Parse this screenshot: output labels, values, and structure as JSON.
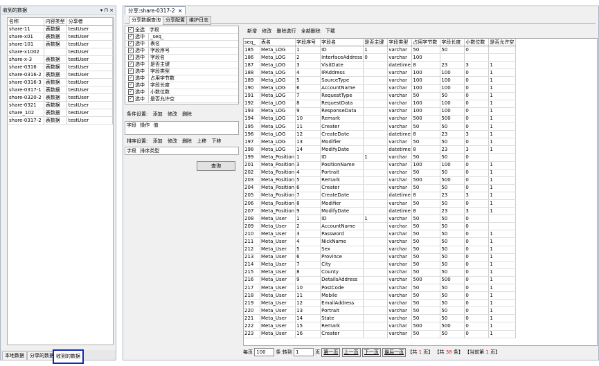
{
  "left_panel": {
    "title": "收到的数据",
    "controls": "▾ ⊓ ×",
    "columns": [
      "名称",
      "内容类型",
      "分享者"
    ],
    "rows": [
      [
        "share-11",
        "表数据",
        "testUser"
      ],
      [
        "share-x01",
        "表数据",
        "testUser"
      ],
      [
        "share-101",
        "表数据",
        "testUser"
      ],
      [
        "share-x1002",
        "",
        "testUser"
      ],
      [
        "share-x-3",
        "表数据",
        "testUser"
      ],
      [
        "share-0316",
        "表数据",
        "testUser"
      ],
      [
        "share-0316-2",
        "表数据",
        "testUser"
      ],
      [
        "share-0316-3",
        "表数据",
        "testUser"
      ],
      [
        "share-0317-1",
        "表数据",
        "testUser"
      ],
      [
        "share-0320-2",
        "表数据",
        "testUser"
      ],
      [
        "share-0321",
        "表数据",
        "testUser"
      ],
      [
        "share_102",
        "表数据",
        "testUser"
      ],
      [
        "share-0317-2",
        "表数据",
        "testUser"
      ]
    ],
    "bottom_tabs": [
      "本地数据",
      "分享的数据",
      "收到的数据"
    ]
  },
  "doc_tab": {
    "title": "分享:share-0317-2",
    "close": "×"
  },
  "sub_tabs": [
    "分享数据查询",
    "分享配置",
    "维护日志"
  ],
  "fields": {
    "select_all": "全选",
    "field_header": "字段",
    "select_label": "选中",
    "items": [
      "_seq_",
      "表名",
      "字段序号",
      "字段名",
      "是否主键",
      "字段类型",
      "占用字节数",
      "字段长度",
      "小数位数",
      "是否允许空"
    ]
  },
  "condition": {
    "label": "条件设置:",
    "actions": [
      "添加",
      "修改",
      "删除"
    ],
    "columns": [
      "字段",
      "操作",
      "值"
    ]
  },
  "sort": {
    "label": "排序设置:",
    "actions": [
      "添加",
      "修改",
      "删除",
      "上移",
      "下移"
    ],
    "columns": [
      "字段",
      "排序类型"
    ]
  },
  "query_button": "查询",
  "grid_toolbar": [
    "新增",
    "修改",
    "删除选行",
    "全部删除",
    "下载"
  ],
  "grid": {
    "columns": [
      "seq_",
      "表名",
      "字段序号",
      "字段名",
      "是否主键",
      "字段类型",
      "占用字节数",
      "字段长度",
      "小数位数",
      "是否允许空"
    ],
    "rows": [
      [
        "185",
        "Meta_LOG",
        "1",
        "ID",
        "1",
        "varchar",
        "50",
        "50",
        "0",
        ""
      ],
      [
        "186",
        "Meta_LOG",
        "2",
        "InterfaceAddress",
        "0",
        "varchar",
        "100",
        "",
        "",
        ""
      ],
      [
        "187",
        "Meta_LOG",
        "3",
        "VisitDate",
        "",
        "datetime",
        "8",
        "23",
        "3",
        "1"
      ],
      [
        "188",
        "Meta_LOG",
        "4",
        "IPAddress",
        "",
        "varchar",
        "100",
        "100",
        "0",
        "1"
      ],
      [
        "189",
        "Meta_LOG",
        "5",
        "SourceType",
        "",
        "varchar",
        "100",
        "100",
        "0",
        "1"
      ],
      [
        "190",
        "Meta_LOG",
        "6",
        "AccountName",
        "",
        "varchar",
        "100",
        "100",
        "0",
        "1"
      ],
      [
        "191",
        "Meta_LOG",
        "7",
        "RequestType",
        "",
        "varchar",
        "50",
        "50",
        "0",
        "1"
      ],
      [
        "192",
        "Meta_LOG",
        "8",
        "RequestData",
        "",
        "varchar",
        "100",
        "100",
        "0",
        "1"
      ],
      [
        "193",
        "Meta_LOG",
        "9",
        "ResponseData",
        "",
        "varchar",
        "100",
        "100",
        "0",
        "1"
      ],
      [
        "194",
        "Meta_LOG",
        "10",
        "Remark",
        "",
        "varchar",
        "500",
        "500",
        "0",
        "1"
      ],
      [
        "195",
        "Meta_LOG",
        "11",
        "Creater",
        "",
        "varchar",
        "50",
        "50",
        "0",
        "1"
      ],
      [
        "196",
        "Meta_LOG",
        "12",
        "CreateDate",
        "",
        "datetime",
        "8",
        "23",
        "3",
        "1"
      ],
      [
        "197",
        "Meta_LOG",
        "13",
        "Modifier",
        "",
        "varchar",
        "50",
        "50",
        "0",
        "1"
      ],
      [
        "198",
        "Meta_LOG",
        "14",
        "ModifyDate",
        "",
        "datetime",
        "8",
        "23",
        "3",
        "1"
      ],
      [
        "199",
        "Meta_Position",
        "1",
        "ID",
        "1",
        "varchar",
        "50",
        "50",
        "0",
        ""
      ],
      [
        "201",
        "Meta_Position",
        "3",
        "PositionName",
        "",
        "varchar",
        "100",
        "100",
        "0",
        "1"
      ],
      [
        "202",
        "Meta_Position",
        "4",
        "Portrait",
        "",
        "varchar",
        "50",
        "50",
        "0",
        "1"
      ],
      [
        "203",
        "Meta_Position",
        "5",
        "Remark",
        "",
        "varchar",
        "500",
        "500",
        "0",
        "1"
      ],
      [
        "204",
        "Meta_Position",
        "6",
        "Creater",
        "",
        "varchar",
        "50",
        "50",
        "0",
        "1"
      ],
      [
        "205",
        "Meta_Position",
        "7",
        "CreateDate",
        "",
        "datetime",
        "8",
        "23",
        "3",
        "1"
      ],
      [
        "206",
        "Meta_Position",
        "8",
        "Modifier",
        "",
        "varchar",
        "50",
        "50",
        "0",
        "1"
      ],
      [
        "207",
        "Meta_Position",
        "9",
        "ModifyDate",
        "",
        "datetime",
        "8",
        "23",
        "3",
        "1"
      ],
      [
        "208",
        "Meta_User",
        "1",
        "ID",
        "1",
        "varchar",
        "50",
        "50",
        "0",
        ""
      ],
      [
        "209",
        "Meta_User",
        "2",
        "AccountName",
        "",
        "varchar",
        "50",
        "50",
        "0",
        ""
      ],
      [
        "210",
        "Meta_User",
        "3",
        "Password",
        "",
        "varchar",
        "50",
        "50",
        "0",
        "1"
      ],
      [
        "211",
        "Meta_User",
        "4",
        "NickName",
        "",
        "varchar",
        "50",
        "50",
        "0",
        "1"
      ],
      [
        "212",
        "Meta_User",
        "5",
        "Sex",
        "",
        "varchar",
        "50",
        "50",
        "0",
        "1"
      ],
      [
        "213",
        "Meta_User",
        "6",
        "Province",
        "",
        "varchar",
        "50",
        "50",
        "0",
        "1"
      ],
      [
        "214",
        "Meta_User",
        "7",
        "City",
        "",
        "varchar",
        "50",
        "50",
        "0",
        "1"
      ],
      [
        "215",
        "Meta_User",
        "8",
        "County",
        "",
        "varchar",
        "50",
        "50",
        "0",
        "1"
      ],
      [
        "216",
        "Meta_User",
        "9",
        "DetailsAddress",
        "",
        "varchar",
        "500",
        "500",
        "0",
        "1"
      ],
      [
        "217",
        "Meta_User",
        "10",
        "PostCode",
        "",
        "varchar",
        "50",
        "50",
        "0",
        "1"
      ],
      [
        "218",
        "Meta_User",
        "11",
        "Mobile",
        "",
        "varchar",
        "50",
        "50",
        "0",
        "1"
      ],
      [
        "219",
        "Meta_User",
        "12",
        "EmailAddress",
        "",
        "varchar",
        "50",
        "50",
        "0",
        "1"
      ],
      [
        "220",
        "Meta_User",
        "13",
        "Portrait",
        "",
        "varchar",
        "50",
        "50",
        "0",
        "1"
      ],
      [
        "221",
        "Meta_User",
        "14",
        "State",
        "",
        "varchar",
        "50",
        "50",
        "0",
        "1"
      ],
      [
        "222",
        "Meta_User",
        "15",
        "Remark",
        "",
        "varchar",
        "500",
        "500",
        "0",
        "1"
      ],
      [
        "223",
        "Meta_User",
        "16",
        "Creater",
        "",
        "varchar",
        "50",
        "50",
        "0",
        "1"
      ]
    ]
  },
  "pager": {
    "per_page_label": "每页",
    "per_page_value": "100",
    "unit_rows": "条",
    "goto_label": "转到",
    "goto_value": "1",
    "unit_page": "页",
    "first": "第一页",
    "prev": "上一页",
    "next": "下一页",
    "last": "最后一页",
    "total_pages_prefix": "【共",
    "total_pages": "1",
    "total_pages_suffix": "页】",
    "total_rows_prefix": "【共",
    "total_rows": "38",
    "total_rows_suffix": "条】",
    "current_prefix": "【当前第",
    "current_page": "1",
    "current_suffix": "页】"
  }
}
